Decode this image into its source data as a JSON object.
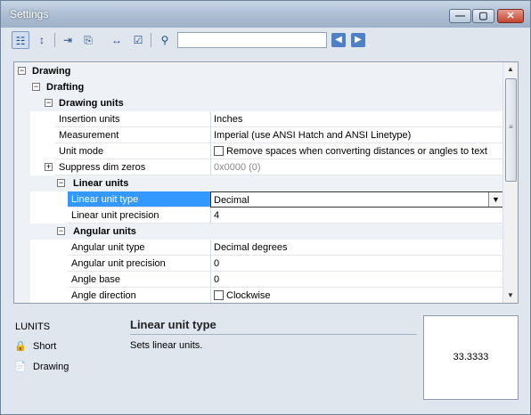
{
  "window": {
    "title": "Settings"
  },
  "titlebar_buttons": {
    "min": "—",
    "max": "▢",
    "close": "✕"
  },
  "toolbar": {
    "icons": [
      "categorized-view-icon",
      "alphabetical-sort-icon",
      "export-icon",
      "import-icon",
      "dimension-icon",
      "checklist-icon",
      "binoculars-icon"
    ],
    "search_value": "",
    "back_glyph": "◀",
    "forward_glyph": "▶"
  },
  "tree": {
    "drawing": "Drawing",
    "drafting": "Drafting",
    "drawing_units": "Drawing units",
    "rows": [
      {
        "name": "Insertion units",
        "value": "Inches"
      },
      {
        "name": "Measurement",
        "value": "Imperial (use ANSI Hatch and ANSI Linetype)"
      },
      {
        "name": "Unit mode",
        "value": "Remove spaces when converting distances or angles to text"
      },
      {
        "name": "Suppress dim zeros",
        "value": "0x0000 (0)"
      }
    ],
    "linear_units": "Linear units",
    "linear_rows": [
      {
        "name": "Linear unit type",
        "value": "Decimal"
      },
      {
        "name": "Linear unit precision",
        "value": "4"
      }
    ],
    "angular_units": "Angular units",
    "angular_rows": [
      {
        "name": "Angular unit type",
        "value": "Decimal degrees"
      },
      {
        "name": "Angular unit precision",
        "value": "0"
      },
      {
        "name": "Angle base",
        "value": "0"
      },
      {
        "name": "Angle direction",
        "value": "Clockwise"
      }
    ]
  },
  "bottom": {
    "command": "LUNITS",
    "items": [
      "Short",
      "Drawing"
    ],
    "desc_title": "Linear unit type",
    "desc_text": "Sets linear units.",
    "preview": "33.3333"
  }
}
